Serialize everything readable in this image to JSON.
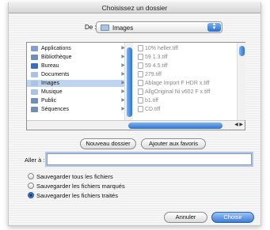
{
  "window": {
    "title": "Choisissez un dossier"
  },
  "location": {
    "label": "De :",
    "value": "Images"
  },
  "sidebar": {
    "items": [
      {
        "label": "Applications",
        "icon": "applications-icon",
        "color": "#7f9fd0"
      },
      {
        "label": "Bibliothèque",
        "icon": "library-folder-icon",
        "color": "#6f8fb8"
      },
      {
        "label": "Bureau",
        "icon": "desktop-icon",
        "color": "#3a6fc0"
      },
      {
        "label": "Documents",
        "icon": "documents-folder-icon",
        "color": "#a9c3e2"
      },
      {
        "label": "Images",
        "icon": "pictures-folder-icon",
        "color": "#a9c3e2",
        "selected": true
      },
      {
        "label": "Musique",
        "icon": "music-folder-icon",
        "color": "#a9c3e2"
      },
      {
        "label": "Public",
        "icon": "public-folder-icon",
        "color": "#6f8fb8"
      },
      {
        "label": "Séquences",
        "icon": "movies-folder-icon",
        "color": "#6f8fb8"
      }
    ]
  },
  "files": {
    "items": [
      {
        "label": "10% heller.tiff"
      },
      {
        "label": "59 1.3.tiff"
      },
      {
        "label": "59 4.5.tiff"
      },
      {
        "label": "279.tiff"
      },
      {
        "label": "Ablage Import F HDR x.tiff"
      },
      {
        "label": "AllgOriginal Ni v602 F x.tiff"
      },
      {
        "label": "b1.tiff"
      },
      {
        "label": "CD.tiff"
      }
    ]
  },
  "actions": {
    "new_folder": "Nouveau dossier",
    "add_favorite": "Ajouter aux favoris"
  },
  "goto": {
    "label": "Aller à :",
    "value": ""
  },
  "options": [
    {
      "label": "Sauvegarder tous les fichiers",
      "selected": false
    },
    {
      "label": "Sauvegarder les fichiers marqués",
      "selected": false
    },
    {
      "label": "Sauvegarder les fichiers traités",
      "selected": true
    }
  ],
  "footer": {
    "cancel": "Annuler",
    "choose": "Choisir"
  }
}
